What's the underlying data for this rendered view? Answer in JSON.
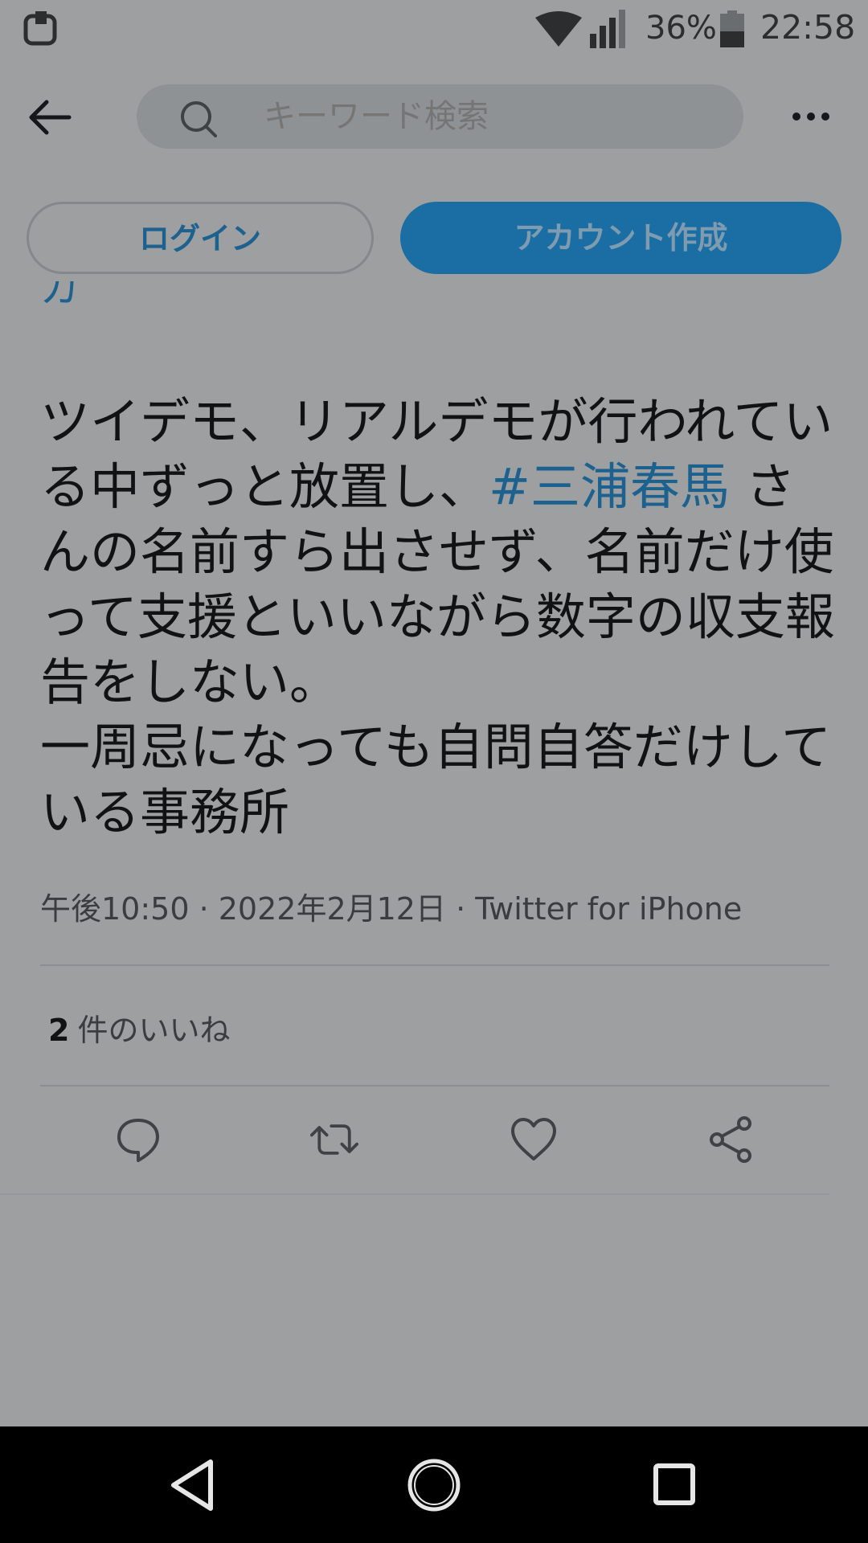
{
  "status_bar": {
    "battery_percent": "36%",
    "time": "22:58"
  },
  "top_bar": {
    "search_placeholder": "キーワード検索"
  },
  "auth_buttons": {
    "login_label": "ログイン",
    "signup_label": "アカウント作成"
  },
  "tweet": {
    "text_part1": "ツイデモ、リアルデモが行われている中ずっと放置し、",
    "hashtag": "#三浦春馬",
    "text_part2": " さんの名前すら出させず、名前だけ使って支援といいながら数字の収支報告をしない。\n一周忌になっても自問自答だけしている事務所",
    "meta": "午後10:50 · 2022年2月12日 · Twitter for iPhone",
    "like_count": "2",
    "like_label": "件のいいね"
  },
  "colors": {
    "accent": "#1d9bf0",
    "overlay_background": "#9d9fa1",
    "nav_background": "#000000"
  },
  "icons": {
    "status_left": "notification-icon",
    "wifi": "wifi-icon",
    "signal": "signal-icon",
    "battery": "battery-icon",
    "back": "back-arrow-icon",
    "search": "search-icon",
    "more": "more-icon",
    "reply": "reply-icon",
    "retweet": "retweet-icon",
    "like": "heart-icon",
    "share": "share-icon",
    "nav_back": "nav-back-icon",
    "nav_home": "nav-home-icon",
    "nav_recents": "nav-recents-icon"
  }
}
